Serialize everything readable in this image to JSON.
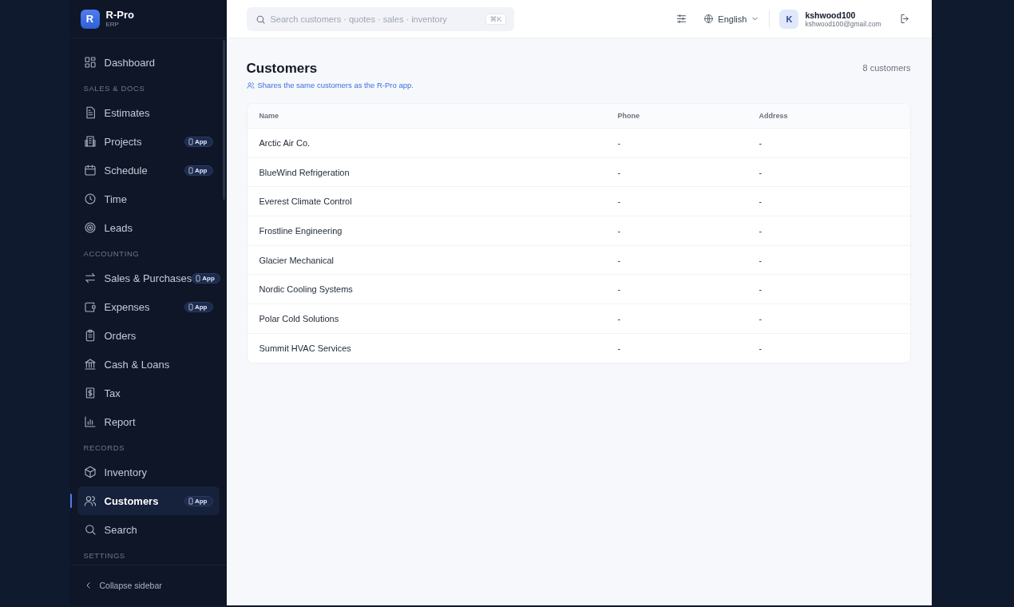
{
  "brand": {
    "logo": "R",
    "name": "R-Pro",
    "sub": "ERP"
  },
  "sidebar": {
    "items": [
      {
        "kind": "item",
        "label": "Dashboard",
        "selected": false
      },
      {
        "kind": "section",
        "label": "SALES & DOCS"
      },
      {
        "kind": "item",
        "label": "Estimates",
        "selected": false
      },
      {
        "kind": "item",
        "label": "Projects",
        "badge": "App",
        "selected": false
      },
      {
        "kind": "item",
        "label": "Schedule",
        "badge": "App",
        "selected": false
      },
      {
        "kind": "item",
        "label": "Time",
        "selected": false
      },
      {
        "kind": "item",
        "label": "Leads",
        "selected": false
      },
      {
        "kind": "section",
        "label": "ACCOUNTING"
      },
      {
        "kind": "item",
        "label": "Sales & Purchases",
        "badge": "App",
        "selected": false
      },
      {
        "kind": "item",
        "label": "Expenses",
        "badge": "App",
        "selected": false
      },
      {
        "kind": "item",
        "label": "Orders",
        "selected": false
      },
      {
        "kind": "item",
        "label": "Cash & Loans",
        "selected": false
      },
      {
        "kind": "item",
        "label": "Tax",
        "selected": false
      },
      {
        "kind": "item",
        "label": "Report",
        "selected": false
      },
      {
        "kind": "section",
        "label": "RECORDS"
      },
      {
        "kind": "item",
        "label": "Inventory",
        "selected": false
      },
      {
        "kind": "item",
        "label": "Customers",
        "badge": "App",
        "selected": true
      },
      {
        "kind": "item",
        "label": "Search",
        "selected": false
      },
      {
        "kind": "section",
        "label": "SETTINGS"
      }
    ],
    "collapse": "Collapse sidebar"
  },
  "topbar": {
    "search": {
      "placeholder": "Search customers · quotes · sales · inventory",
      "shortcut": "⌘K"
    },
    "language": "English",
    "user": {
      "initial": "K",
      "name": "kshwood100",
      "email": "kshwood100@gmail.com"
    }
  },
  "page": {
    "title": "Customers",
    "note": "Shares the same customers as the R-Pro app.",
    "count": "8 customers"
  },
  "table": {
    "columns": [
      "Name",
      "Phone",
      "Address"
    ],
    "rows": [
      [
        "Arctic Air Co.",
        "-",
        "-"
      ],
      [
        "BlueWind Refrigeration",
        "-",
        "-"
      ],
      [
        "Everest Climate Control",
        "-",
        "-"
      ],
      [
        "Frostline Engineering",
        "-",
        "-"
      ],
      [
        "Glacier Mechanical",
        "-",
        "-"
      ],
      [
        "Nordic Cooling Systems",
        "-",
        "-"
      ],
      [
        "Polar Cold Solutions",
        "-",
        "-"
      ],
      [
        "Summit HVAC Services",
        "-",
        "-"
      ]
    ]
  }
}
